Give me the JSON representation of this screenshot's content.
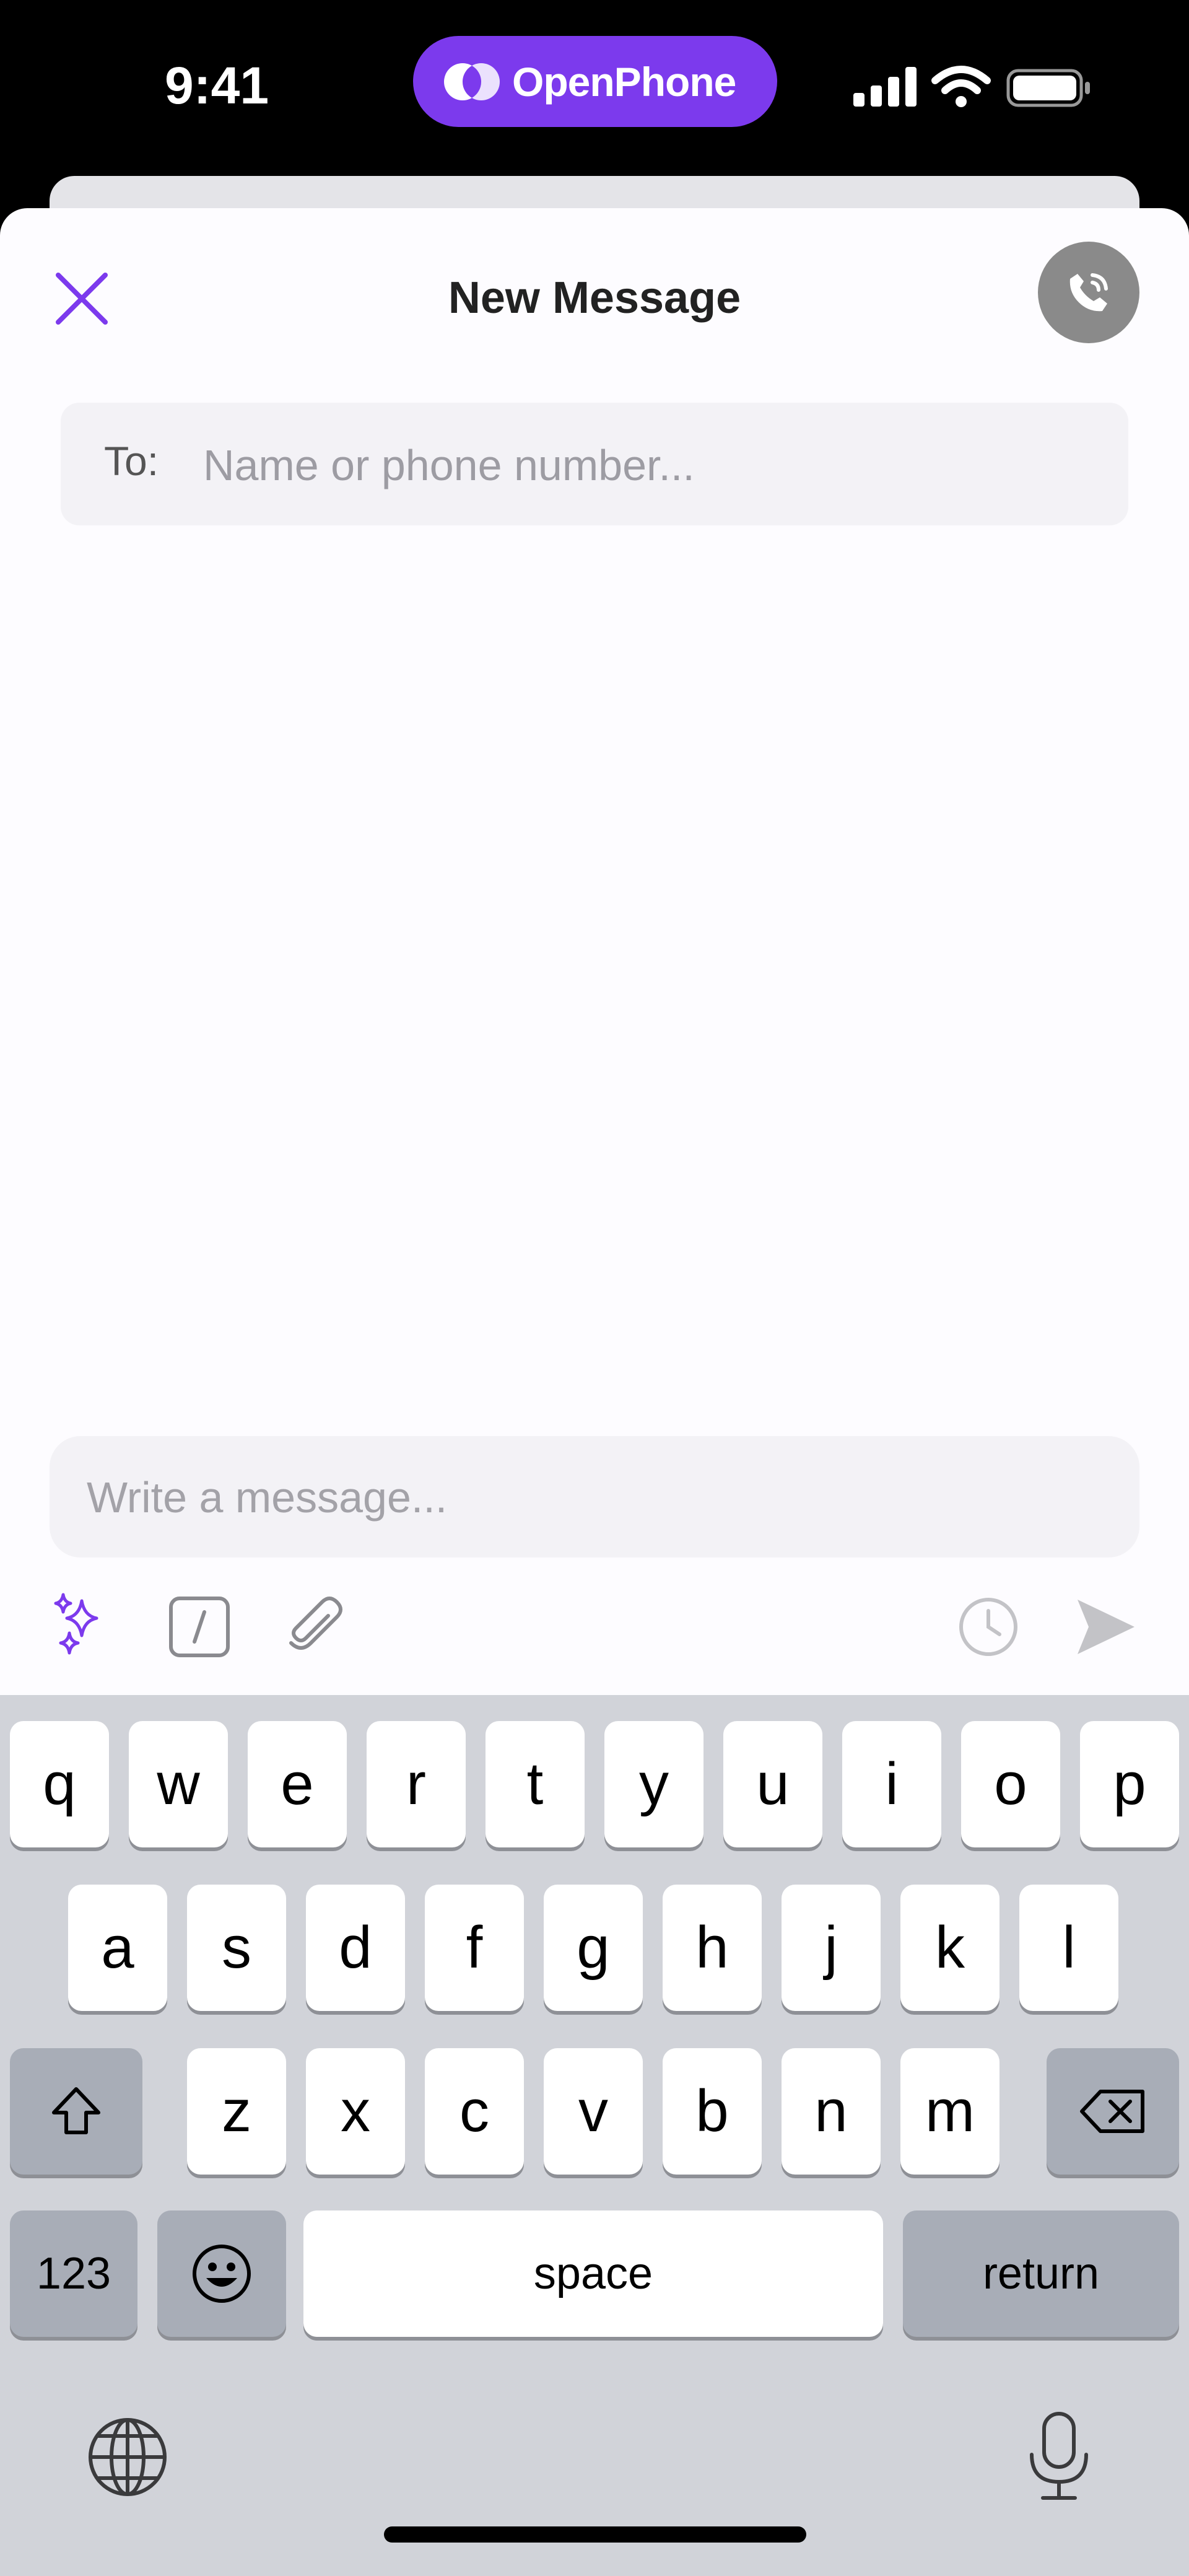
{
  "status_bar": {
    "time": "9:41",
    "app_pill": {
      "label": "OpenPhone",
      "color": "#7c3aed"
    },
    "icons": [
      "cellular-signal-icon",
      "wifi-icon",
      "battery-icon"
    ]
  },
  "header": {
    "title": "New Message",
    "close_icon": "close-icon",
    "call_icon": "phone-call-icon"
  },
  "to_field": {
    "label": "To:",
    "value": "",
    "placeholder": "Name or phone number..."
  },
  "composer": {
    "value": "",
    "placeholder": "Write a message...",
    "toolbar": {
      "left": [
        "sparkles-icon",
        "slash-command-icon",
        "paperclip-icon"
      ],
      "right": [
        "clock-icon",
        "send-icon"
      ]
    }
  },
  "keyboard": {
    "row1": [
      "q",
      "w",
      "e",
      "r",
      "t",
      "y",
      "u",
      "i",
      "o",
      "p"
    ],
    "row2": [
      "a",
      "s",
      "d",
      "f",
      "g",
      "h",
      "j",
      "k",
      "l"
    ],
    "row3": [
      "z",
      "x",
      "c",
      "v",
      "b",
      "n",
      "m"
    ],
    "numbers_label": "123",
    "space_label": "space",
    "return_label": "return",
    "icons": [
      "shift-icon",
      "backspace-icon",
      "emoji-icon",
      "globe-icon",
      "microphone-icon"
    ]
  },
  "colors": {
    "accent": "#7c3aed",
    "sheet_bg": "#fdfcff",
    "field_bg": "#f3f2f6",
    "keyboard_bg": "#d1d3d9"
  }
}
